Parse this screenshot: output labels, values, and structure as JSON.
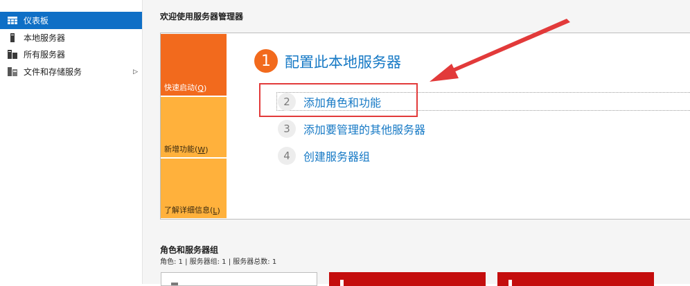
{
  "sidebar": {
    "items": [
      {
        "label": "仪表板",
        "icon": "dashboard-grid-icon",
        "active": true
      },
      {
        "label": "本地服务器",
        "icon": "server-icon"
      },
      {
        "label": "所有服务器",
        "icon": "servers-icon"
      },
      {
        "label": "文件和存储服务",
        "icon": "file-storage-icon",
        "has_submenu": true,
        "arrow": "▷"
      }
    ]
  },
  "main": {
    "welcome_title": "欢迎使用服务器管理器",
    "tiles": {
      "quick_start": {
        "label": "快速启动(",
        "key": "Q",
        "suffix": ")"
      },
      "whats_new": {
        "label": "新增功能(",
        "key": "W",
        "suffix": ")"
      },
      "learn_more": {
        "label": "了解详细信息(",
        "key": "L",
        "suffix": ")"
      }
    },
    "step1": {
      "number": "1",
      "label": "配置此本地服务器"
    },
    "steps": [
      {
        "number": "2",
        "label": "添加角色和功能"
      },
      {
        "number": "3",
        "label": "添加要管理的其他服务器"
      },
      {
        "number": "4",
        "label": "创建服务器组"
      }
    ],
    "roles": {
      "title": "角色和服务器组",
      "summary": "角色: 1 | 服务器组: 1 | 服务器总数: 1"
    }
  },
  "colors": {
    "accent_blue": "#0f6fc6",
    "link_blue": "#1679c5",
    "tile_orange": "#f26a1d",
    "tile_yellow": "#ffb13c",
    "annotation_red": "#e23a3a",
    "card_red": "#c40d0d"
  }
}
